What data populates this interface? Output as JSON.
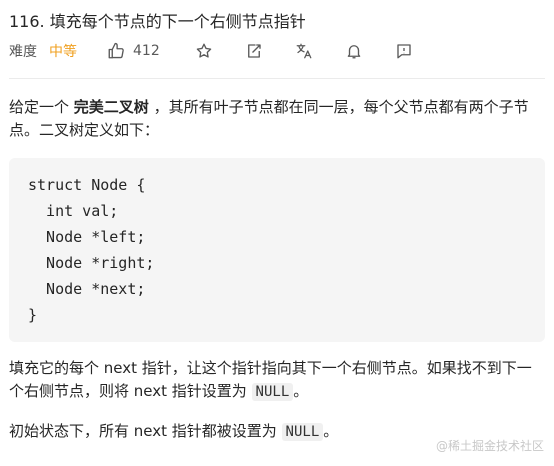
{
  "problem": {
    "title": "116. 填充每个节点的下一个右侧节点指针",
    "difficulty_label": "难度",
    "difficulty_value": "中等",
    "likes": "412"
  },
  "toolbar_icons": [
    "thumbs-up-icon",
    "star-icon",
    "share-icon",
    "translate-icon",
    "bell-icon",
    "comment-icon"
  ],
  "description": {
    "intro_before": "给定一个 ",
    "intro_bold": "完美二叉树",
    "intro_after": " ，其所有叶子节点都在同一层，每个父节点都有两个子节点。二叉树定义如下：",
    "code_lines": [
      "struct Node {",
      "  int val;",
      "  Node *left;",
      "  Node *right;",
      "  Node *next;",
      "}"
    ],
    "para2_before": "填充它的每个 next 指针，让这个指针指向其下一个右侧节点。如果找不到下一个右侧节点，则将 next 指针设置为 ",
    "para2_code": "NULL",
    "para2_after": "。",
    "para3_before": "初始状态下，所有 next 指针都被设置为 ",
    "para3_code": "NULL",
    "para3_after": "。"
  },
  "watermark": "@稀土掘金技术社区",
  "colors": {
    "difficulty": "#f0a020",
    "code_bg": "#f5f5f5",
    "divider": "#ebebeb"
  }
}
